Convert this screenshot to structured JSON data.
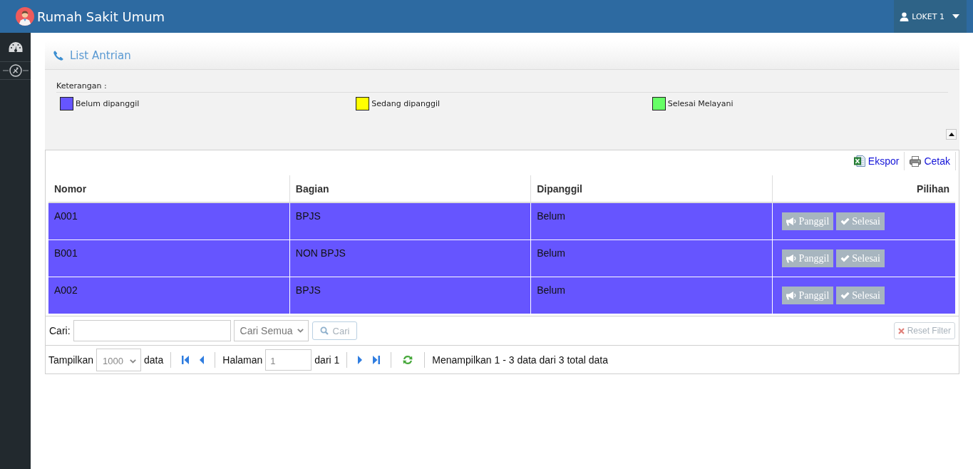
{
  "navbar": {
    "brand": "Rumah Sakit Umum",
    "user_menu": "LOKET 1"
  },
  "panel": {
    "title": "List Antrian",
    "legend": {
      "label": "Keterangan :",
      "items": [
        {
          "label": "Belum dipanggil",
          "color": "#6655ff"
        },
        {
          "label": "Sedang dipanggil",
          "color": "#ffff00"
        },
        {
          "label": "Selesai Melayani",
          "color": "#66ff66"
        }
      ]
    }
  },
  "toolbar": {
    "links": [
      {
        "kind": "excel",
        "label": "Ekspor"
      },
      {
        "kind": "print",
        "label": "Cetak"
      }
    ]
  },
  "table": {
    "columns": [
      "Nomor",
      "Bagian",
      "Dipanggil",
      "Pilihan"
    ],
    "rows": [
      {
        "cells": [
          "A001",
          "BPJS",
          "Belum"
        ],
        "color": "#6655ff",
        "actions": [
          {
            "kind": "call",
            "label": "Panggil",
            "disabled": true
          },
          {
            "kind": "done",
            "label": "Selesai",
            "disabled": true
          }
        ]
      },
      {
        "cells": [
          "B001",
          "NON BPJS",
          "Belum"
        ],
        "color": "#6655ff",
        "actions": [
          {
            "kind": "call",
            "label": "Panggil",
            "disabled": true
          },
          {
            "kind": "done",
            "label": "Selesai",
            "disabled": true
          }
        ]
      },
      {
        "cells": [
          "A002",
          "BPJS",
          "Belum"
        ],
        "color": "#6655ff",
        "actions": [
          {
            "kind": "call",
            "label": "Panggil",
            "disabled": true
          },
          {
            "kind": "done",
            "label": "Selesai",
            "disabled": true
          }
        ]
      }
    ]
  },
  "search": {
    "label": "Cari:",
    "scope": "Cari Semua",
    "button": {
      "label": "Cari",
      "disabled": true
    },
    "reset": {
      "label": "Reset Filter",
      "disabled": true
    }
  },
  "pager": {
    "show_label": "Tampilkan",
    "page_size": "1000",
    "unit": "data",
    "page_label": "Halaman",
    "page": "1",
    "of_label": "dari 1",
    "summary": "Menampilkan 1 - 3 data dari 3 total data"
  }
}
